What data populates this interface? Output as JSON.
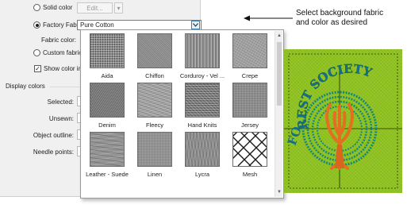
{
  "dialog": {
    "solid_color": "Solid color",
    "edit_button": "Edit...",
    "edit_arrow": "▾",
    "factory_fabric": "Factory Fabric:",
    "factory_value": "Pure Cotton",
    "fabric_color": "Fabric color:",
    "custom_fabric": "Custom fabric:",
    "show_color": "Show color insid",
    "display_colors": "Display colors",
    "selected": "Selected:",
    "unsewn": "Unsewn:",
    "object_outline": "Object outline:",
    "needle_points": "Needle points:"
  },
  "fabrics": [
    {
      "name": "Aida",
      "texture": "aida"
    },
    {
      "name": "Chiffon",
      "texture": "chiffon"
    },
    {
      "name": "Corduroy - Vel ...",
      "texture": "corduroy"
    },
    {
      "name": "Crepe",
      "texture": "crepe"
    },
    {
      "name": "Denim",
      "texture": "denim"
    },
    {
      "name": "Fleecy",
      "texture": "fleecy"
    },
    {
      "name": "Hand Knits",
      "texture": "knits"
    },
    {
      "name": "Jersey",
      "texture": "jersey"
    },
    {
      "name": "Leather - Suede",
      "texture": "suede"
    },
    {
      "name": "Linen",
      "texture": "linen"
    },
    {
      "name": "Lycra",
      "texture": "lycra"
    },
    {
      "name": "Mesh",
      "texture": "mesh"
    }
  ],
  "callout": {
    "line1": "Select background fabric",
    "line2": "and color as desired"
  },
  "design": {
    "text_top": "REST SOCIETY",
    "text_left": "FO"
  },
  "colors": {
    "fabric_green": "#8fc31f",
    "embroidery_teal": "#15837a",
    "tree_orange": "#e8792a"
  }
}
